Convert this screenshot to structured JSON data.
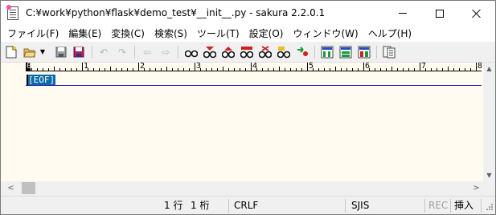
{
  "window": {
    "title": "C:¥work¥python¥flask¥demo_test¥__init__.py - sakura 2.2.0.1",
    "icon": "sakura-notepad-icon"
  },
  "menu": [
    {
      "label": "ファイル(F)"
    },
    {
      "label": "編集(E)"
    },
    {
      "label": "変換(C)"
    },
    {
      "label": "検索(S)"
    },
    {
      "label": "ツール(T)"
    },
    {
      "label": "設定(O)"
    },
    {
      "label": "ウィンドウ(W)"
    },
    {
      "label": "ヘルプ(H)"
    }
  ],
  "toolbar": {
    "icons": {
      "new": "new-file-icon",
      "open": "open-folder-icon",
      "save": "save-icon",
      "save_all": "save-all-icon",
      "undo": "undo-icon",
      "redo": "redo-icon",
      "back": "jump-back-icon",
      "forward": "jump-forward-icon",
      "search": "search-icon",
      "search_next": "search-next-icon",
      "search_prev": "search-prev-icon",
      "grep": "grep-icon",
      "clear_mark": "clear-mark-icon",
      "tag_jump": "tag-jump-icon",
      "outline": "outline-icon",
      "compare": "compare-icon",
      "window_tile": "tile-icon",
      "window_cascade": "cascade-icon",
      "settings": "settings-icon"
    },
    "colors": {
      "accent_red": "#d02020",
      "accent_green": "#1a9a3a",
      "accent_blue": "#2050c0",
      "accent_yellow": "#e8c020"
    }
  },
  "ruler": {
    "numbers": [
      "0",
      "1",
      "2",
      "3",
      "4",
      "5",
      "6",
      "7",
      "8"
    ]
  },
  "editor": {
    "eof_text": "[EOF]",
    "background": "#fffbf0",
    "eof_background": "#0b6aa8"
  },
  "status": {
    "line": "1 行",
    "column": "1 桁",
    "newline": "CRLF",
    "encoding": "SJIS",
    "rec": "REC",
    "insert_mode": "挿入"
  }
}
